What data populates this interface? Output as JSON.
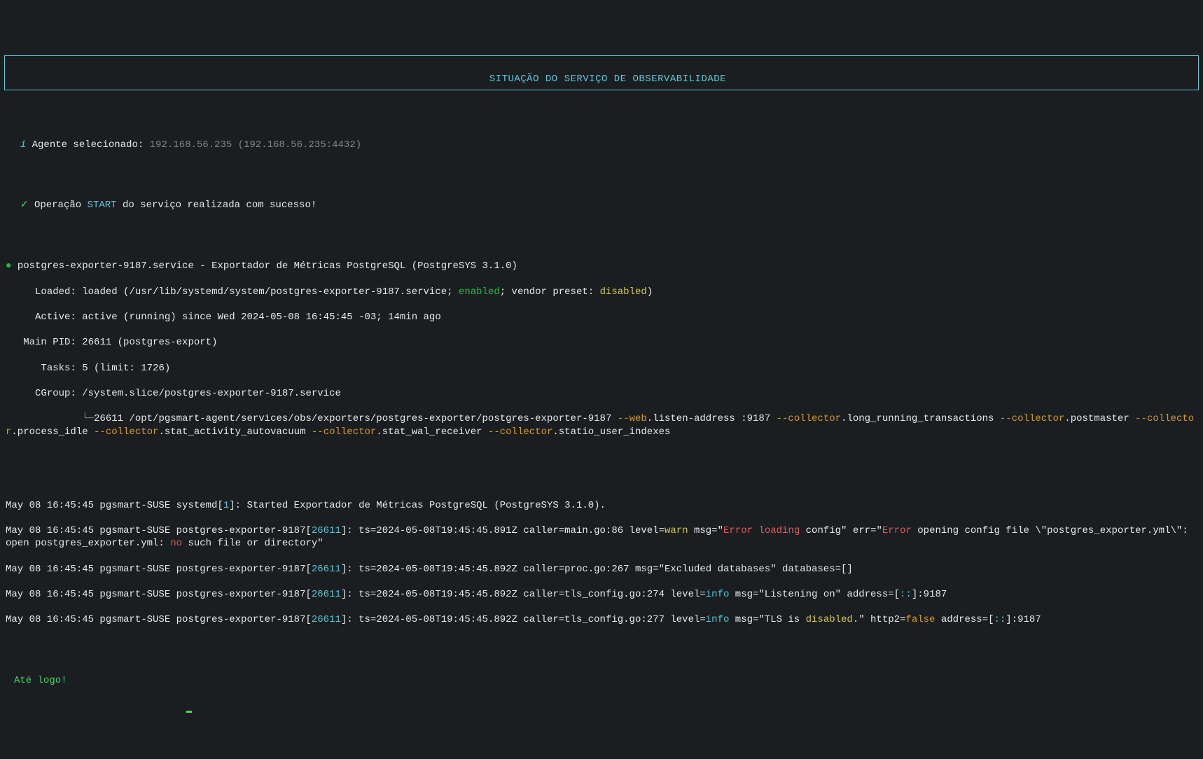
{
  "header": {
    "title": "SITUAÇÃO DO SERVIÇO DE OBSERVABILIDADE"
  },
  "agent": {
    "icon": "i",
    "label": "Agente selecionado: ",
    "ip": "192.168.56.235",
    "endpoint": "(192.168.56.235:4432)"
  },
  "result": {
    "check": "✓",
    "pre": "Operação ",
    "op": "START",
    "post": " do serviço realizada com sucesso!"
  },
  "svc": {
    "bullet": "●",
    "name": "postgres-exporter-9187.service",
    "desc": " - Exportador de Métricas PostgreSQL (PostgreSYS 3.1.0)",
    "loaded_label": "     Loaded: ",
    "loaded_pre": "loaded (/usr/lib/systemd/system/postgres-exporter-9187.service; ",
    "enabled": "enabled",
    "loaded_mid": "; vendor preset: ",
    "disabled": "disabled",
    "loaded_post": ")",
    "active_label": "     Active: ",
    "active_val": "active (running)",
    "active_since": " since Wed 2024-05-08 16:45:45 -03; 14min ago",
    "pid_label": "   Main PID: ",
    "pid_val": "26611 (postgres-export)",
    "tasks_label": "      Tasks: ",
    "tasks_val": "5 (limit: 1726)",
    "cgroup_label": "     CGroup: ",
    "cgroup_val": "/system.slice/postgres-exporter-9187.service",
    "tree_branch": "             └─",
    "cmd_pid": "26611",
    "cmd_bin": " /opt/pgsmart-agent/services/obs/exporters/postgres-exporter/postgres-exporter-9187 ",
    "fl_web": "--web",
    "fl_web_v": ".listen-address :9187 ",
    "fl_col": "--collector",
    "fl_c1": ".long_running_transactions ",
    "fl_c2": ".postmaster ",
    "fl_c3": ".process_idle ",
    "fl_c4": ".stat_activity_autovacuum ",
    "fl_c5": ".stat_wal_receiver ",
    "fl_c6": ".statio_user_indexes"
  },
  "log": {
    "l1_pre": "May 08 16:45:45 pgsmart-SUSE systemd[",
    "l1_pid": "1",
    "l1_post": "]: Started Exportador de Métricas PostgreSQL (PostgreSYS 3.1.0).",
    "l2_pre": "May 08 16:45:45 pgsmart-SUSE postgres-exporter-9187[",
    "l2_pid": "26611",
    "l2_a": "]: ts=2024-05-08T19:45:45.891Z caller=main.go:86 level=",
    "l2_warn": "warn",
    "l2_b": " msg=\"",
    "l2_err1a": "Error",
    "l2_c": " ",
    "l2_err1b": "loading",
    "l2_d": " config\" err=\"",
    "l2_err2": "Error",
    "l2_e": " opening config file \\\"postgres_exporter.yml\\\": open postgres_exporter.yml: ",
    "l2_no": "no",
    "l2_f": " such file or directory\"",
    "l3_pre": "May 08 16:45:45 pgsmart-SUSE postgres-exporter-9187[",
    "l3_pid": "26611",
    "l3_body": "]: ts=2024-05-08T19:45:45.892Z caller=proc.go:267 msg=\"Excluded databases\" databases=[]",
    "l4_pre": "May 08 16:45:45 pgsmart-SUSE postgres-exporter-9187[",
    "l4_pid": "26611",
    "l4_a": "]: ts=2024-05-08T19:45:45.892Z caller=tls_config.go:274 level=",
    "l4_info": "info",
    "l4_b": " msg=\"Listening on\" address=[",
    "l4_addr": "::",
    "l4_c": "]:9187",
    "l5_pre": "May 08 16:45:45 pgsmart-SUSE postgres-exporter-9187[",
    "l5_pid": "26611",
    "l5_a": "]: ts=2024-05-08T19:45:45.892Z caller=tls_config.go:277 level=",
    "l5_info": "info",
    "l5_b": " msg=\"TLS is ",
    "l5_dis": "disabled",
    "l5_c": ".\" http2=",
    "l5_false": "false",
    "l5_d": " address=[",
    "l5_addr": "::",
    "l5_e": "]:9187"
  },
  "farewell": "Até logo!"
}
